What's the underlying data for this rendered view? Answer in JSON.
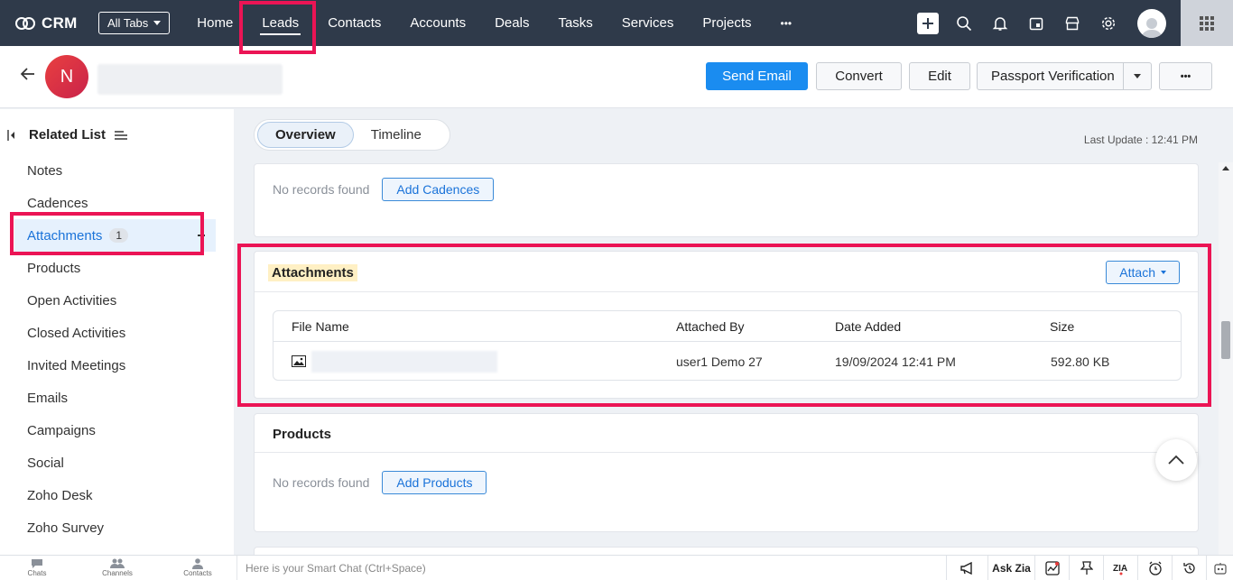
{
  "app": {
    "name": "CRM"
  },
  "nav": {
    "all_tabs": "All Tabs",
    "tabs": [
      "Home",
      "Leads",
      "Contacts",
      "Accounts",
      "Deals",
      "Tasks",
      "Services",
      "Projects"
    ],
    "active_tab": "Leads",
    "more": "•••"
  },
  "record": {
    "avatar_letter": "N",
    "buttons": {
      "send_email": "Send Email",
      "convert": "Convert",
      "edit": "Edit",
      "passport": "Passport Verification",
      "more": "•••"
    }
  },
  "sidebar": {
    "title": "Related List",
    "items": [
      {
        "label": "Notes"
      },
      {
        "label": "Cadences"
      },
      {
        "label": "Attachments",
        "count": "1"
      },
      {
        "label": "Products"
      },
      {
        "label": "Open Activities"
      },
      {
        "label": "Closed Activities"
      },
      {
        "label": "Invited Meetings"
      },
      {
        "label": "Emails"
      },
      {
        "label": "Campaigns"
      },
      {
        "label": "Social"
      },
      {
        "label": "Zoho Desk"
      },
      {
        "label": "Zoho Survey"
      }
    ]
  },
  "view": {
    "tabs": [
      "Overview",
      "Timeline"
    ],
    "last_update": "Last Update : 12:41 PM"
  },
  "cadences": {
    "no_records": "No records found",
    "add": "Add Cadences"
  },
  "attachments": {
    "title": "Attachments",
    "attach_button": "Attach",
    "columns": [
      "File Name",
      "Attached By",
      "Date Added",
      "Size"
    ],
    "rows": [
      {
        "attached_by": "user1 Demo 27",
        "date_added": "19/09/2024 12:41 PM",
        "size": "592.80 KB"
      }
    ]
  },
  "products": {
    "title": "Products",
    "no_records": "No records found",
    "add": "Add Products"
  },
  "bottom": {
    "items": [
      "Chats",
      "Channels",
      "Contacts"
    ],
    "smart_chat": "Here is your Smart Chat (Ctrl+Space)",
    "ask_zia": "Ask Zia"
  },
  "colors": {
    "nav_bg": "#2f3a4a",
    "primary": "#1a8cf0",
    "highlight": "#eb1455"
  }
}
